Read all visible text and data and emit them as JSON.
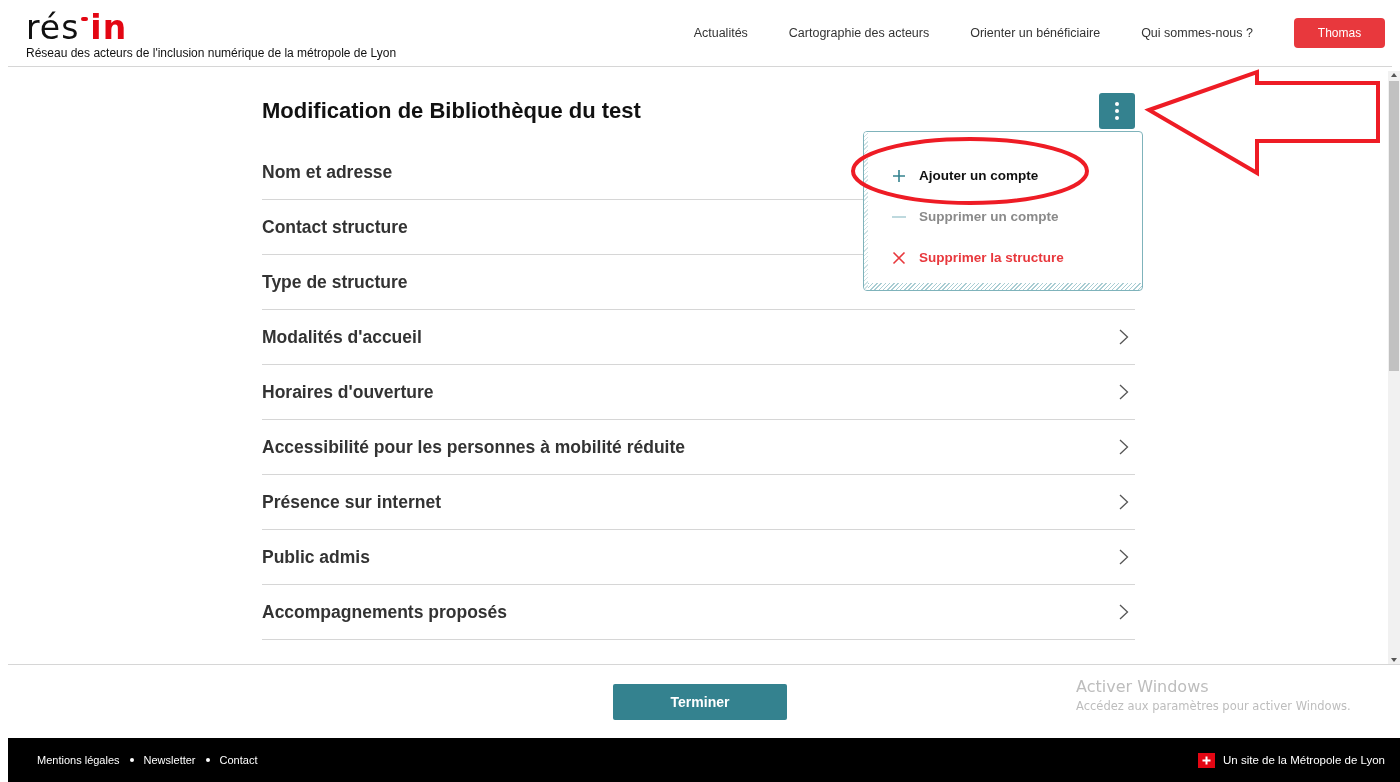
{
  "header": {
    "logo": [
      "rés",
      "in"
    ],
    "tagline": "Réseau des acteurs de l'inclusion numérique de la métropole de Lyon",
    "nav": [
      {
        "label": "Actualités"
      },
      {
        "label": "Cartographie des acteurs"
      },
      {
        "label": "Orienter un bénéficiaire"
      },
      {
        "label": "Qui sommes-nous ?"
      }
    ],
    "user_button": "Thomas"
  },
  "page": {
    "title": "Modification de Bibliothèque du test",
    "sections": [
      {
        "label": "Nom et adresse"
      },
      {
        "label": "Contact structure"
      },
      {
        "label": "Type de structure"
      },
      {
        "label": "Modalités d'accueil",
        "chevron": true
      },
      {
        "label": "Horaires d'ouverture",
        "chevron": true
      },
      {
        "label": "Accessibilité pour les personnes à mobilité réduite",
        "chevron": true
      },
      {
        "label": "Présence sur internet",
        "chevron": true
      },
      {
        "label": "Public admis",
        "chevron": true
      },
      {
        "label": "Accompagnements proposés",
        "chevron": true
      }
    ],
    "menu": {
      "open": true,
      "items": [
        {
          "kind": "add",
          "label": "Ajouter un compte",
          "disabled": false
        },
        {
          "kind": "remove",
          "label": "Supprimer un compte",
          "disabled": true
        },
        {
          "kind": "delete",
          "label": "Supprimer la structure",
          "disabled": false
        }
      ]
    },
    "finish_button": "Terminer"
  },
  "os_notice": {
    "title": "Activer Windows",
    "text": "Accédez aux paramètres pour activer Windows."
  },
  "footer": {
    "links": [
      {
        "label": "Mentions légales"
      },
      {
        "label": "Newsletter"
      },
      {
        "label": "Contact"
      }
    ],
    "credit": "Un site de la Métropole de Lyon"
  }
}
